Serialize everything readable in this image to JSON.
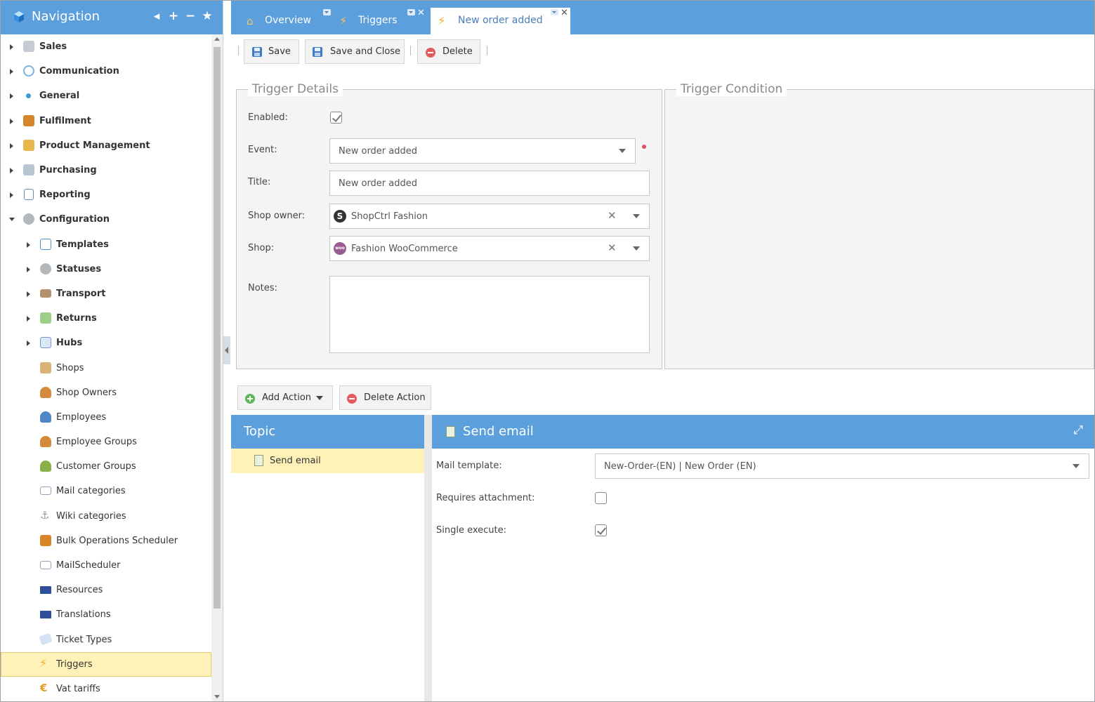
{
  "nav": {
    "title": "Navigation",
    "tools": {
      "collapse": "◂",
      "add": "+",
      "remove": "−",
      "favorite": "★"
    },
    "items": [
      {
        "label": "Sales",
        "icon": "cash-register-icon",
        "color": "#9aa7b5"
      },
      {
        "label": "Communication",
        "icon": "speech-bubbles-icon",
        "color": "#7fb2de"
      },
      {
        "label": "General",
        "icon": "dot-icon",
        "color": "#3a9ad9"
      },
      {
        "label": "Fulfilment",
        "icon": "box-icon",
        "color": "#d9862b"
      },
      {
        "label": "Product Management",
        "icon": "package-icon",
        "color": "#e8b94a"
      },
      {
        "label": "Purchasing",
        "icon": "cart-icon",
        "color": "#8aa0b8"
      },
      {
        "label": "Reporting",
        "icon": "report-icon",
        "color": "#6c87b5"
      },
      {
        "label": "Configuration",
        "icon": "gear-icon",
        "color": "#9aa0a6"
      },
      {
        "label": "Templates",
        "icon": "template-icon",
        "color": "#4f8fd0"
      },
      {
        "label": "Statuses",
        "icon": "gear-icon",
        "color": "#9aa0a6"
      },
      {
        "label": "Transport",
        "icon": "truck-icon",
        "color": "#a07a50"
      },
      {
        "label": "Returns",
        "icon": "return-icon",
        "color": "#5aa85a"
      },
      {
        "label": "Hubs",
        "icon": "hub-icon",
        "color": "#6f9ac9"
      },
      {
        "label": "Shops",
        "icon": "shop-icon",
        "color": "#c9a060"
      },
      {
        "label": "Shop Owners",
        "icon": "user-icon",
        "color": "#d38a3a"
      },
      {
        "label": "Employees",
        "icon": "user-icon",
        "color": "#4f86c6"
      },
      {
        "label": "Employee Groups",
        "icon": "users-icon",
        "color": "#d38a3a"
      },
      {
        "label": "Customer Groups",
        "icon": "users-icon",
        "color": "#8ab04a"
      },
      {
        "label": "Mail categories",
        "icon": "mail-icon",
        "color": "#8aa4c2"
      },
      {
        "label": "Wiki categories",
        "icon": "anchor-icon",
        "color": "#8a9aaa"
      },
      {
        "label": "Bulk Operations Scheduler",
        "icon": "box-icon",
        "color": "#d9862b"
      },
      {
        "label": "MailScheduler",
        "icon": "mail-icon",
        "color": "#8aa4c2"
      },
      {
        "label": "Resources",
        "icon": "flag-icon",
        "color": "#2f4f9a"
      },
      {
        "label": "Translations",
        "icon": "flag-icon",
        "color": "#2f4f9a"
      },
      {
        "label": "Ticket Types",
        "icon": "tag-icon",
        "color": "#9ab8d8"
      },
      {
        "label": "Triggers",
        "icon": "lightning-icon",
        "color": "#f0b020"
      },
      {
        "label": "Vat tariffs",
        "icon": "euro-icon",
        "color": "#e0a020"
      }
    ]
  },
  "tabs": [
    {
      "label": "Overview",
      "icon": "home-icon"
    },
    {
      "label": "Triggers",
      "icon": "lightning-icon"
    },
    {
      "label": "New order added",
      "icon": "lightning-icon"
    }
  ],
  "toolbar": {
    "save": "Save",
    "save_close": "Save and Close",
    "delete": "Delete"
  },
  "trigger_details": {
    "legend": "Trigger Details",
    "enabled_label": "Enabled:",
    "enabled": true,
    "event_label": "Event:",
    "event_value": "New order added",
    "title_label": "Title:",
    "title_value": "New order added",
    "shop_owner_label": "Shop owner:",
    "shop_owner_value": "ShopCtrl Fashion",
    "shop_label": "Shop:",
    "shop_value": "Fashion WooCommerce",
    "shop_badge": "woo",
    "notes_label": "Notes:",
    "notes_value": ""
  },
  "trigger_condition": {
    "legend": "Trigger Condition"
  },
  "actions": {
    "add": "Add Action",
    "delete": "Delete Action"
  },
  "topic": {
    "header": "Topic",
    "items": [
      {
        "label": "Send email"
      }
    ]
  },
  "send_email": {
    "header": "Send email",
    "mail_template_label": "Mail template:",
    "mail_template_value": "New-Order-(EN) | New Order (EN)",
    "requires_attachment_label": "Requires attachment:",
    "requires_attachment": false,
    "single_execute_label": "Single execute:",
    "single_execute": true
  },
  "colors": {
    "accent": "#5b9fdc",
    "selected": "#fff2b8",
    "panel": "#f4f4f4"
  }
}
